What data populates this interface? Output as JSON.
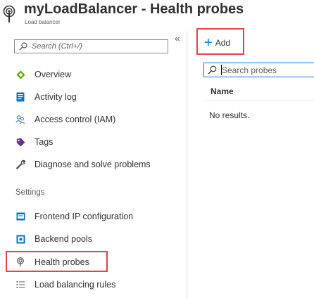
{
  "header": {
    "title": "myLoadBalancer - Health probes",
    "subtitle": "Load balancer",
    "icon": "health-probe-icon"
  },
  "sidebar": {
    "collapse_glyph": "«",
    "search_placeholder": "Search (Ctrl+/)",
    "items": [
      {
        "label": "Overview",
        "icon": "overview-diamond-icon"
      },
      {
        "label": "Activity log",
        "icon": "activity-log-icon"
      },
      {
        "label": "Access control (IAM)",
        "icon": "people-icon"
      },
      {
        "label": "Tags",
        "icon": "tag-icon"
      },
      {
        "label": "Diagnose and solve problems",
        "icon": "wrench-icon"
      }
    ],
    "section_label": "Settings",
    "settings_items": [
      {
        "label": "Frontend IP configuration",
        "icon": "frontend-ip-icon"
      },
      {
        "label": "Backend pools",
        "icon": "backend-pools-icon"
      },
      {
        "label": "Health probes",
        "icon": "health-probe-icon",
        "selected": true
      },
      {
        "label": "Load balancing rules",
        "icon": "rules-list-icon"
      }
    ]
  },
  "main": {
    "add_label": "Add",
    "add_icon": "plus-icon",
    "search_placeholder": "Search probes",
    "column_header": "Name",
    "empty_text": "No results."
  },
  "colors": {
    "accent": "#0078d4",
    "highlight": "#e3434a"
  }
}
